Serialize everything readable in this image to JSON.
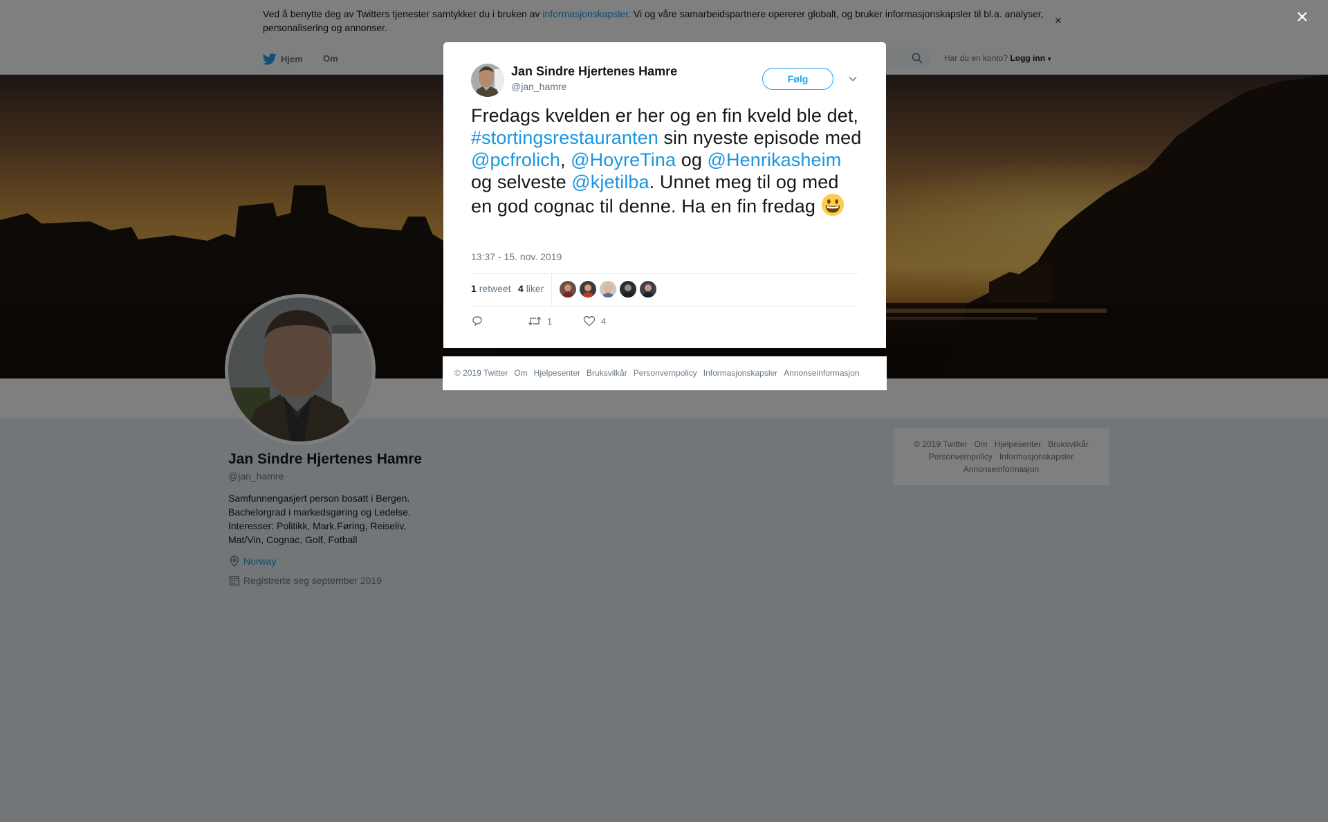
{
  "cookie": {
    "text_before": "Ved å benytte deg av Twitters tjenester samtykker du i bruken av ",
    "link": "informasjonskapsler",
    "text_after": ". Vi og våre samarbeidspartnere opererer globalt, og bruker informasjonskapsler til bl.a. analyser, personalisering og annonser.",
    "close": "×"
  },
  "nav": {
    "home": "Hjem",
    "about": "Om",
    "account_prompt": "Har du en konto?",
    "login": "Logg inn"
  },
  "profile": {
    "name": "Jan Sindre Hjertenes Hamre",
    "handle": "@jan_hamre",
    "bio": "Samfunnengasjert person bosatt i Bergen. Bachelorgrad i markedsgøring og Ledelse. Interesser: Politikk, Mark.Føring, Reiseliv, Mat/Vin, Cognac, Golf, Fotball",
    "location": "Norway",
    "joined": "Registrerte seg september 2019"
  },
  "side_footer": {
    "links": [
      "© 2019 Twitter",
      "Om",
      "Hjelpesenter",
      "Bruksvilkår",
      "Personvernpolicy",
      "Informasjonskapsler",
      "Annonseinformasjon"
    ]
  },
  "overlay": {
    "close": "×"
  },
  "tweet": {
    "name": "Jan Sindre Hjertenes Hamre",
    "handle": "@jan_hamre",
    "follow_label": "Følg",
    "text": {
      "p1": "Fredags kvelden er her og en fin kveld ble det, ",
      "hashtag": "#stortingsrestauranten",
      "p2": " sin nyeste episode med ",
      "m1": "@pcfrolich",
      "p3": ", ",
      "m2": "@HoyreTina",
      "p4": " og ",
      "m3": "@Henrikasheim",
      "p5": " og selveste ",
      "m4": "@kjetilba",
      "p6": ". Unnet meg til og med en god cognac til denne. Ha en fin fredag "
    },
    "timestamp": "13:37 - 15. nov. 2019",
    "retweet_count": "1",
    "retweet_label": "retweet",
    "like_count": "4",
    "like_label": "liker",
    "action_retweets": "1",
    "action_likes": "4"
  },
  "modal_footer": {
    "links": [
      "© 2019 Twitter",
      "Om",
      "Hjelpesenter",
      "Bruksvilkår",
      "Personvernpolicy",
      "Informasjonskapsler",
      "Annonseinformasjon"
    ]
  },
  "colors": {
    "link": "#1b95e0",
    "accent": "#1da1f2",
    "background": "#e6ecf0"
  }
}
